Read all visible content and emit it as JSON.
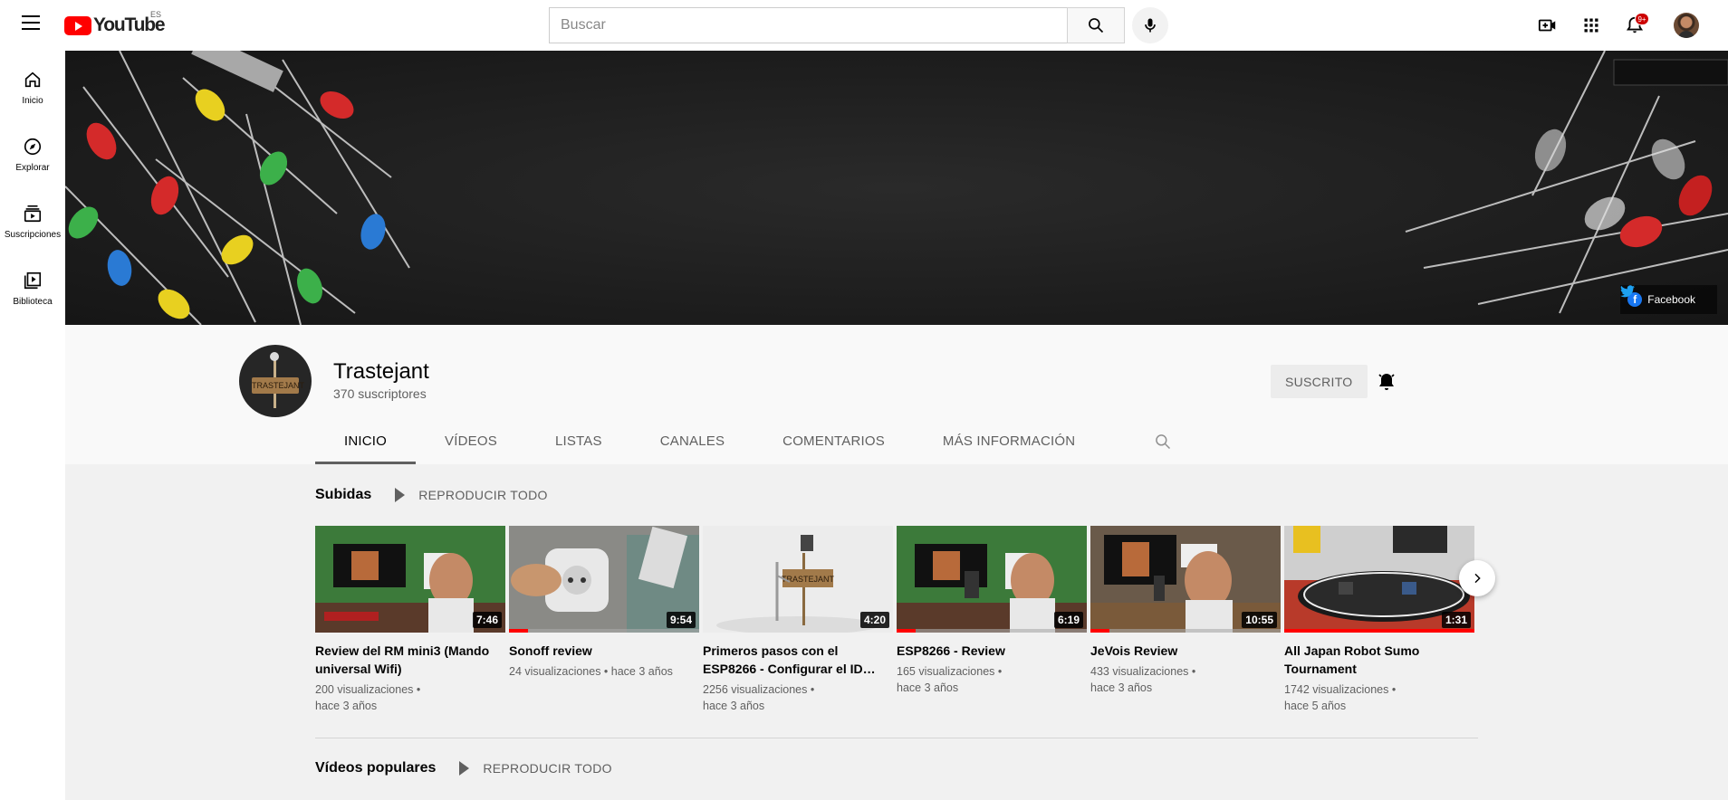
{
  "topbar": {
    "logo_text": "YouTube",
    "country_code": "ES",
    "search_placeholder": "Buscar",
    "notification_count": "9+"
  },
  "guide": {
    "items": [
      {
        "label": "Inicio",
        "icon": "home-icon"
      },
      {
        "label": "Explorar",
        "icon": "compass-icon"
      },
      {
        "label": "Suscripciones",
        "icon": "subscriptions-icon"
      },
      {
        "label": "Biblioteca",
        "icon": "library-icon"
      }
    ]
  },
  "banner": {
    "links": [
      {
        "label": "Facebook",
        "icon": "facebook-icon"
      },
      {
        "label": "",
        "icon": "twitter-icon"
      }
    ]
  },
  "channel": {
    "name": "Trastejant",
    "subscribers": "370 suscriptores",
    "subscribed_label": "SUSCRITO",
    "avatar_text": "TRASTEJANT",
    "tabs": [
      "INICIO",
      "VÍDEOS",
      "LISTAS",
      "CANALES",
      "COMENTARIOS",
      "MÁS INFORMACIÓN"
    ],
    "active_tab": "INICIO"
  },
  "shelves": [
    {
      "title": "Subidas",
      "play_all": "REPRODUCIR TODO"
    },
    {
      "title": "Vídeos populares",
      "play_all": "REPRODUCIR TODO"
    }
  ],
  "videos": [
    {
      "title": "Review del RM mini3 (Mando universal Wifi)",
      "views": "200 visualizaciones",
      "age": "hace 3 años",
      "duration": "7:46",
      "watched_fraction": 0.0
    },
    {
      "title": "Sonoff review",
      "views": "24 visualizaciones",
      "age": "hace 3 años",
      "duration": "9:54",
      "watched_fraction": 0.1
    },
    {
      "title": "Primeros pasos con el ESP8266 - Configurar el ID…",
      "views": "2256 visualizaciones",
      "age": "hace 3 años",
      "duration": "4:20",
      "watched_fraction": 0.0
    },
    {
      "title": "ESP8266 - Review",
      "views": "165 visualizaciones",
      "age": "hace 3 años",
      "duration": "6:19",
      "watched_fraction": 0.1
    },
    {
      "title": "JeVois Review",
      "views": "433 visualizaciones",
      "age": "hace 3 años",
      "duration": "10:55",
      "watched_fraction": 0.1
    },
    {
      "title": "All Japan Robot Sumo Tournament",
      "views": "1742 visualizaciones",
      "age": "hace 5 años",
      "duration": "1:31",
      "watched_fraction": 1.0
    }
  ],
  "colors": {
    "brand_red": "#ff0000",
    "accent_grey": "#606060"
  }
}
